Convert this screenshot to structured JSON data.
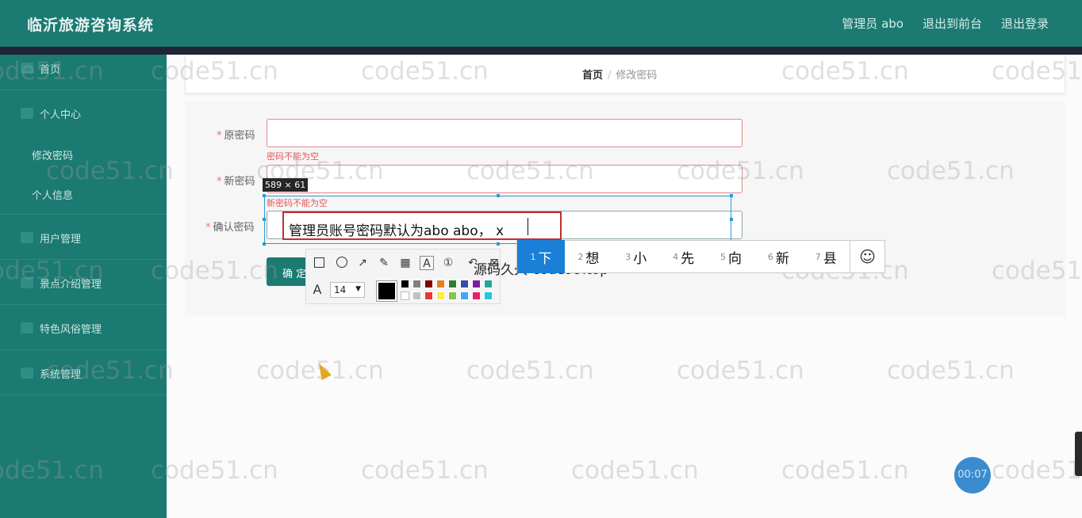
{
  "app": {
    "title": "临沂旅游咨询系统",
    "nav": [
      "管理员 abo",
      "退出到前台",
      "退出登录"
    ]
  },
  "sidebar": {
    "items": [
      {
        "label": "首页",
        "icon": "home-icon"
      },
      {
        "label": "个人中心",
        "icon": "user-icon"
      },
      {
        "label": "修改密码"
      },
      {
        "label": "个人信息"
      },
      {
        "label": "用户管理",
        "icon": "users-icon"
      },
      {
        "label": "景点介绍管理",
        "icon": "location-icon"
      },
      {
        "label": "特色风俗管理",
        "icon": "list-icon"
      },
      {
        "label": "系统管理",
        "icon": "settings-icon"
      }
    ]
  },
  "breadcrumb": {
    "home": "首页",
    "separator": "/",
    "current": "修改密码"
  },
  "form": {
    "old_password": {
      "label": "原密码",
      "error": "密码不能为空"
    },
    "new_password": {
      "label": "新密码",
      "error": "新密码不能为空"
    },
    "confirm_password": {
      "label": "确认密码"
    },
    "submit_label": "确 定"
  },
  "screenshot_tool": {
    "size_label": "589 × 61",
    "text_value": "管理员账号密码默认为abo abo， x",
    "font_size": "14",
    "current_color": "#000000",
    "palette_top": [
      "#000000",
      "#808080",
      "#800000",
      "#e67e22",
      "#2e7d32",
      "#3949ab",
      "#7b1fa2",
      "#26a69a"
    ],
    "palette_bottom": [
      "#ffffff",
      "#c0c0c0",
      "#e53935",
      "#ffeb3b",
      "#8bc34a",
      "#42a5f5",
      "#e91e63",
      "#26c6da"
    ]
  },
  "ime": {
    "candidates": [
      {
        "n": "1",
        "text": "下"
      },
      {
        "n": "2",
        "text": "想"
      },
      {
        "n": "3",
        "text": "小"
      },
      {
        "n": "4",
        "text": "先"
      },
      {
        "n": "5",
        "text": "向"
      },
      {
        "n": "6",
        "text": "新"
      },
      {
        "n": "7",
        "text": "县"
      }
    ],
    "emoji": "☺"
  },
  "overlay_text": "源码久久-code99.top",
  "watermark": "code51.cn",
  "timer": "00:07"
}
